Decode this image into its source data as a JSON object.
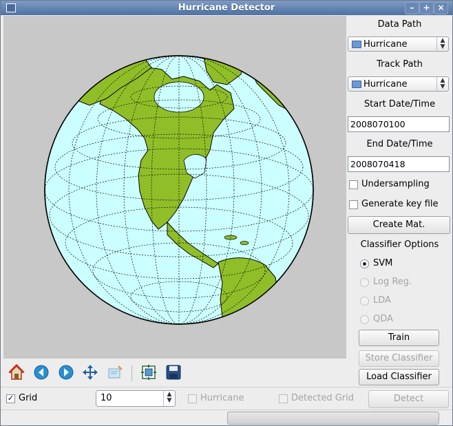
{
  "window": {
    "title": "Hurricane Detector"
  },
  "panel": {
    "data_path_label": "Data Path",
    "data_path_value": "Hurricane",
    "track_path_label": "Track Path",
    "track_path_value": "Hurricane",
    "start_label": "Start Date/Time",
    "start_value": "2008070100",
    "end_label": "End Date/Time",
    "end_value": "2008070418",
    "undersampling_label": "Undersampling",
    "keyfile_label": "Generate key file",
    "create_mat_label": "Create Mat.",
    "classifier_label": "Classifier Options",
    "classifiers": [
      {
        "label": "SVM",
        "selected": true,
        "enabled": true
      },
      {
        "label": "Log Reg.",
        "selected": false,
        "enabled": false
      },
      {
        "label": "LDA",
        "selected": false,
        "enabled": false
      },
      {
        "label": "QDA",
        "selected": false,
        "enabled": false
      }
    ],
    "train_label": "Train",
    "store_label": "Store Classifier",
    "load_label": "Load Classifier"
  },
  "toolbar": {
    "icons": [
      "home-icon",
      "back-icon",
      "forward-icon",
      "pan-icon",
      "zoom-icon",
      "configure-icon",
      "save-icon"
    ]
  },
  "bottom": {
    "grid_label": "Grid",
    "grid_checked": true,
    "grid_size": "10",
    "hurricane_label": "Hurricane",
    "detected_grid_label": "Detected Grid",
    "detect_label": "Detect"
  },
  "colors": {
    "ocean": "#ccffff",
    "land": "#8fbe28",
    "canvas_bg": "#c8c8c8",
    "title_bar": "#5a7cae"
  }
}
